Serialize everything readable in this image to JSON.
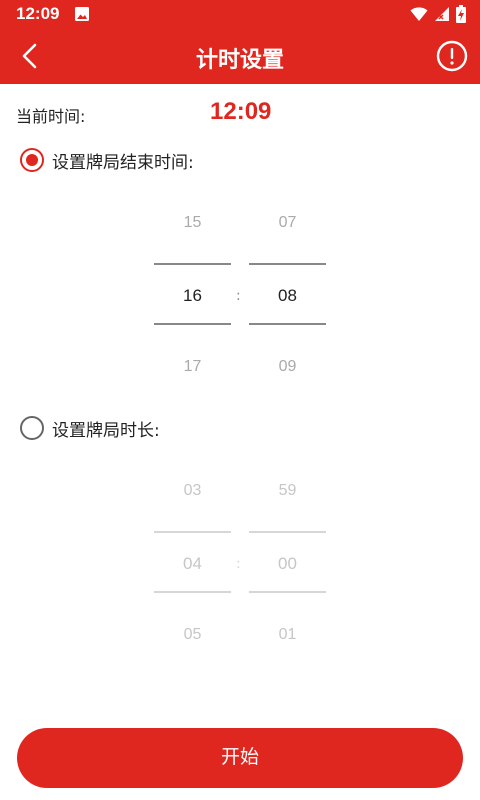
{
  "status_bar": {
    "time": "12:09"
  },
  "header": {
    "title": "计时设置"
  },
  "current": {
    "label": "当前时间:",
    "time": "12:09"
  },
  "option_end_time": {
    "label": "设置牌局结束时间:",
    "checked": true,
    "hours": [
      "15",
      "16",
      "17"
    ],
    "minutes": [
      "07",
      "08",
      "09"
    ],
    "separator": ":"
  },
  "option_duration": {
    "label": "设置牌局时长:",
    "checked": false,
    "hours": [
      "03",
      "04",
      "05"
    ],
    "minutes": [
      "59",
      "00",
      "01"
    ],
    "separator": ":"
  },
  "start_button": {
    "label": "开始"
  },
  "colors": {
    "primary": "#e0271f",
    "text": "#222222",
    "muted": "#aaaaaa"
  }
}
